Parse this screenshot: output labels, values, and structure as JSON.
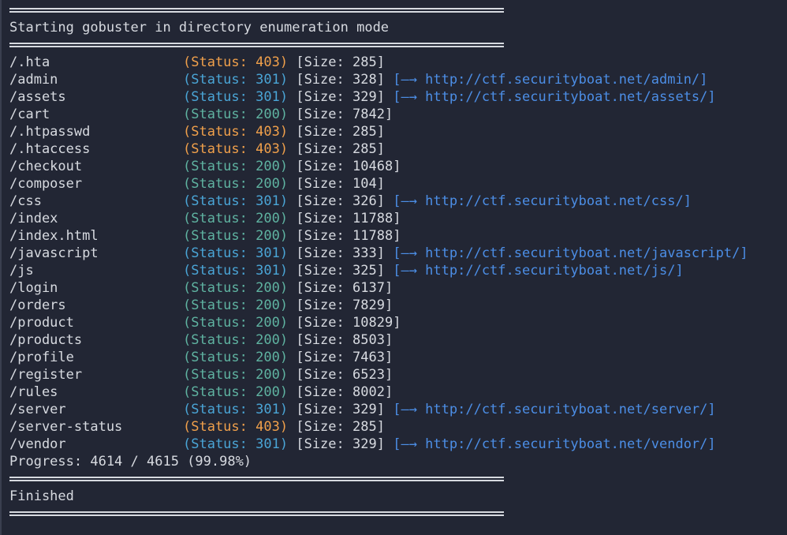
{
  "header_text": "Starting gobuster in directory enumeration mode",
  "results": [
    {
      "path": "/.hta",
      "status": "403",
      "size": "285",
      "redirect": ""
    },
    {
      "path": "/admin",
      "status": "301",
      "size": "328",
      "redirect": "http://ctf.securityboat.net/admin/"
    },
    {
      "path": "/assets",
      "status": "301",
      "size": "329",
      "redirect": "http://ctf.securityboat.net/assets/"
    },
    {
      "path": "/cart",
      "status": "200",
      "size": "7842",
      "redirect": ""
    },
    {
      "path": "/.htpasswd",
      "status": "403",
      "size": "285",
      "redirect": ""
    },
    {
      "path": "/.htaccess",
      "status": "403",
      "size": "285",
      "redirect": ""
    },
    {
      "path": "/checkout",
      "status": "200",
      "size": "10468",
      "redirect": ""
    },
    {
      "path": "/composer",
      "status": "200",
      "size": "104",
      "redirect": ""
    },
    {
      "path": "/css",
      "status": "301",
      "size": "326",
      "redirect": "http://ctf.securityboat.net/css/"
    },
    {
      "path": "/index",
      "status": "200",
      "size": "11788",
      "redirect": ""
    },
    {
      "path": "/index.html",
      "status": "200",
      "size": "11788",
      "redirect": ""
    },
    {
      "path": "/javascript",
      "status": "301",
      "size": "333",
      "redirect": "http://ctf.securityboat.net/javascript/"
    },
    {
      "path": "/js",
      "status": "301",
      "size": "325",
      "redirect": "http://ctf.securityboat.net/js/"
    },
    {
      "path": "/login",
      "status": "200",
      "size": "6137",
      "redirect": ""
    },
    {
      "path": "/orders",
      "status": "200",
      "size": "7829",
      "redirect": ""
    },
    {
      "path": "/product",
      "status": "200",
      "size": "10829",
      "redirect": ""
    },
    {
      "path": "/products",
      "status": "200",
      "size": "8503",
      "redirect": ""
    },
    {
      "path": "/profile",
      "status": "200",
      "size": "7463",
      "redirect": ""
    },
    {
      "path": "/register",
      "status": "200",
      "size": "6523",
      "redirect": ""
    },
    {
      "path": "/rules",
      "status": "200",
      "size": "8002",
      "redirect": ""
    },
    {
      "path": "/server",
      "status": "301",
      "size": "329",
      "redirect": "http://ctf.securityboat.net/server/"
    },
    {
      "path": "/server-status",
      "status": "403",
      "size": "285",
      "redirect": ""
    },
    {
      "path": "/vendor",
      "status": "301",
      "size": "329",
      "redirect": "http://ctf.securityboat.net/vendor/"
    }
  ],
  "progress_text": "Progress: 4614 / 4615 (99.98%)",
  "footer_text": "Finished",
  "colors": {
    "background": "#222634",
    "text": "#d7dae0",
    "status_200": "#5fb3a1",
    "status_301": "#4aa5d6",
    "status_403": "#f0a04b",
    "redirect": "#4c8ee6"
  }
}
